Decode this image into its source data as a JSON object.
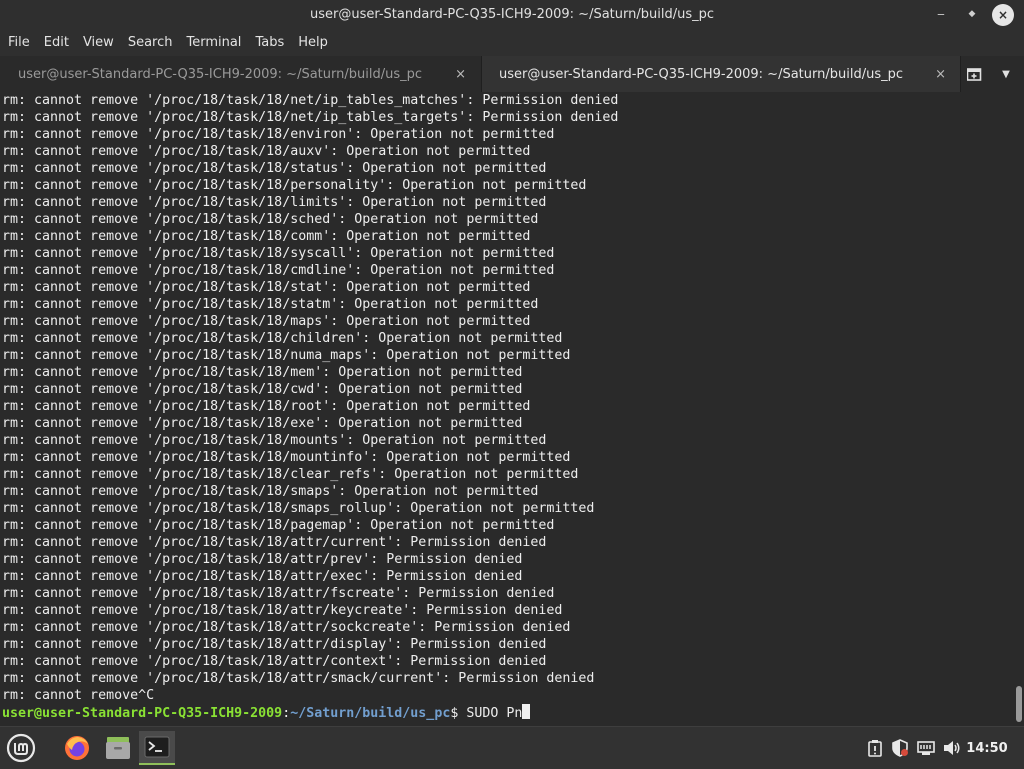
{
  "window": {
    "title": "user@user-Standard-PC-Q35-ICH9-2009: ~/Saturn/build/us_pc",
    "minimize_glyph": "‒",
    "maximize_glyph": "◆",
    "close_glyph": "×"
  },
  "menubar": [
    "File",
    "Edit",
    "View",
    "Search",
    "Terminal",
    "Tabs",
    "Help"
  ],
  "tabs": [
    {
      "label": "user@user-Standard-PC-Q35-ICH9-2009: ~/Saturn/build/us_pc",
      "close": "×",
      "active": false
    },
    {
      "label": "user@user-Standard-PC-Q35-ICH9-2009: ~/Saturn/build/us_pc",
      "close": "×",
      "active": true
    }
  ],
  "tab_actions": {
    "menu_glyph": "▼"
  },
  "terminal": {
    "lines": [
      "rm: cannot remove '/proc/18/task/18/net/ip_tables_matches': Permission denied",
      "rm: cannot remove '/proc/18/task/18/net/ip_tables_targets': Permission denied",
      "rm: cannot remove '/proc/18/task/18/environ': Operation not permitted",
      "rm: cannot remove '/proc/18/task/18/auxv': Operation not permitted",
      "rm: cannot remove '/proc/18/task/18/status': Operation not permitted",
      "rm: cannot remove '/proc/18/task/18/personality': Operation not permitted",
      "rm: cannot remove '/proc/18/task/18/limits': Operation not permitted",
      "rm: cannot remove '/proc/18/task/18/sched': Operation not permitted",
      "rm: cannot remove '/proc/18/task/18/comm': Operation not permitted",
      "rm: cannot remove '/proc/18/task/18/syscall': Operation not permitted",
      "rm: cannot remove '/proc/18/task/18/cmdline': Operation not permitted",
      "rm: cannot remove '/proc/18/task/18/stat': Operation not permitted",
      "rm: cannot remove '/proc/18/task/18/statm': Operation not permitted",
      "rm: cannot remove '/proc/18/task/18/maps': Operation not permitted",
      "rm: cannot remove '/proc/18/task/18/children': Operation not permitted",
      "rm: cannot remove '/proc/18/task/18/numa_maps': Operation not permitted",
      "rm: cannot remove '/proc/18/task/18/mem': Operation not permitted",
      "rm: cannot remove '/proc/18/task/18/cwd': Operation not permitted",
      "rm: cannot remove '/proc/18/task/18/root': Operation not permitted",
      "rm: cannot remove '/proc/18/task/18/exe': Operation not permitted",
      "rm: cannot remove '/proc/18/task/18/mounts': Operation not permitted",
      "rm: cannot remove '/proc/18/task/18/mountinfo': Operation not permitted",
      "rm: cannot remove '/proc/18/task/18/clear_refs': Operation not permitted",
      "rm: cannot remove '/proc/18/task/18/smaps': Operation not permitted",
      "rm: cannot remove '/proc/18/task/18/smaps_rollup': Operation not permitted",
      "rm: cannot remove '/proc/18/task/18/pagemap': Operation not permitted",
      "rm: cannot remove '/proc/18/task/18/attr/current': Permission denied",
      "rm: cannot remove '/proc/18/task/18/attr/prev': Permission denied",
      "rm: cannot remove '/proc/18/task/18/attr/exec': Permission denied",
      "rm: cannot remove '/proc/18/task/18/attr/fscreate': Permission denied",
      "rm: cannot remove '/proc/18/task/18/attr/keycreate': Permission denied",
      "rm: cannot remove '/proc/18/task/18/attr/sockcreate': Permission denied",
      "rm: cannot remove '/proc/18/task/18/attr/display': Permission denied",
      "rm: cannot remove '/proc/18/task/18/attr/context': Permission denied",
      "rm: cannot remove '/proc/18/task/18/attr/smack/current': Permission denied",
      "rm: cannot remove^C"
    ],
    "prompt": {
      "user_host": "user@user-Standard-PC-Q35-ICH9-2009",
      "separator": ":",
      "path": "~/Saturn/build/us_pc",
      "symbol": "$ ",
      "command": "SUDO Pn"
    },
    "colors": {
      "prompt_user": "#8ae234",
      "prompt_path": "#729fcf",
      "background": "#2a2a2a",
      "text": "#ededed"
    }
  },
  "taskbar": {
    "launchers": [
      {
        "name": "mint-menu-icon",
        "active": false
      },
      {
        "name": "firefox-icon",
        "active": false
      },
      {
        "name": "file-manager-icon",
        "active": false
      },
      {
        "name": "terminal-icon",
        "active": true
      }
    ],
    "tray": [
      "update-manager-icon",
      "shield-icon",
      "network-icon",
      "volume-icon"
    ],
    "clock": "14:50",
    "accent": "#8fbf5a"
  }
}
